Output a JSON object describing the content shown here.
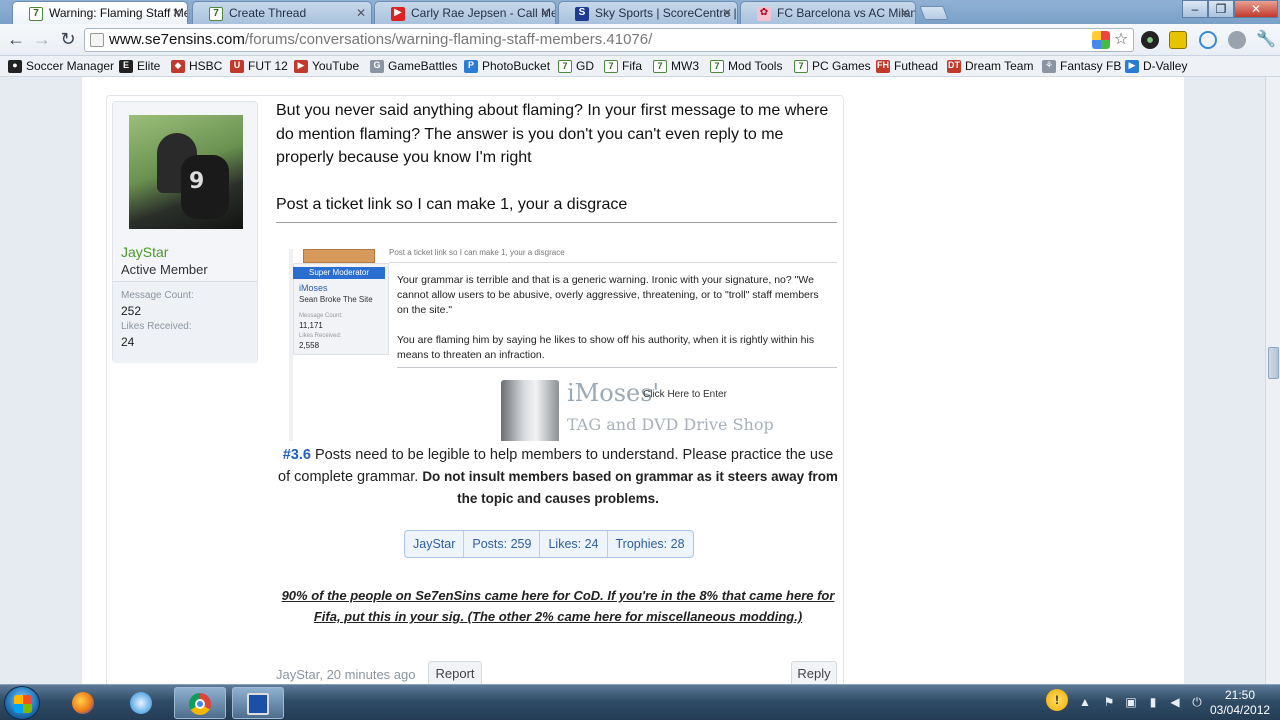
{
  "browser": {
    "tabs": [
      {
        "label": "Warning: Flaming Staff Mer",
        "icon": "se7ensins-icon",
        "active": true
      },
      {
        "label": "Create Thread",
        "icon": "se7ensins-icon"
      },
      {
        "label": "Carly Rae Jepsen - Call Me M",
        "icon": "youtube-icon"
      },
      {
        "label": "Sky Sports | ScoreCentre | Fo",
        "icon": "sky-sports-icon"
      },
      {
        "label": "FC Barcelona vs AC Milan L",
        "icon": "fc-icon"
      }
    ],
    "url_host": "www.se7ensins.com",
    "url_path": "/forums/conversations/warning-flaming-staff-members.41076/",
    "bookmarks": [
      "Soccer Manager",
      "Elite",
      "HSBC",
      "FUT 12",
      "YouTube",
      "GameBattles",
      "PhotoBucket",
      "GD",
      "Fifa",
      "MW3",
      "Mod Tools",
      "PC Games",
      "Futhead",
      "Dream Team",
      "Fantasy FB",
      "D-Valley"
    ]
  },
  "post": {
    "user": {
      "name": "JayStar",
      "title": "Active Member",
      "message_count_label": "Message Count:",
      "message_count": "252",
      "likes_label": "Likes Received:",
      "likes": "24"
    },
    "message_p1": "But you never said anything about flaming? In your first message to me where do mention flaming? The answer is you don't you can't even reply to me properly because you know I'm right",
    "message_p2": "Post a ticket link so I can make 1, your a disgrace",
    "embed": {
      "top_text": "Post a ticket link so I can make 1, your a disgrace",
      "badge": "Super Moderator",
      "name": "iMoses",
      "title": "Sean Broke The Site",
      "mc_label": "Message Count:",
      "mc_value": "11,171",
      "lr_label": "Likes Received:",
      "lr_value": "2,558",
      "p1": "Your grammar is terrible and that is a generic warning. Ironic with your signature, no? \"We cannot allow users to be abusive, overly aggressive, threatening, or to \"troll\" staff members on the site.\"",
      "p2": "You are flaming him by saying he likes to show off his authority, when it is rightly within his means to threaten an infraction.",
      "banner_main": "iMoses'",
      "banner_sub": "Click Here to Enter",
      "banner_sub2": "TAG and DVD Drive Shop"
    },
    "rule_id": "#3.6",
    "rule_text": "Posts need to be legible to help members to understand. Please practice the use of complete grammar.",
    "rule_bold": "Do not insult members based on grammar as it steers away from the topic and causes problems.",
    "sig": {
      "name": "JayStar",
      "posts": "Posts: 259",
      "likes": "Likes: 24",
      "trophies": "Trophies: 28"
    },
    "sig_quote": "90% of the people on Se7enSins came here for CoD. If you're in the 8% that came here for Fifa, put this in your sig. (The other 2% came here for miscellaneous modding.)",
    "meta": "JayStar, 20 minutes ago",
    "report_label": "Report",
    "reply_label": "Reply"
  },
  "taskbar": {
    "time": "21:50",
    "date": "03/04/2012"
  }
}
